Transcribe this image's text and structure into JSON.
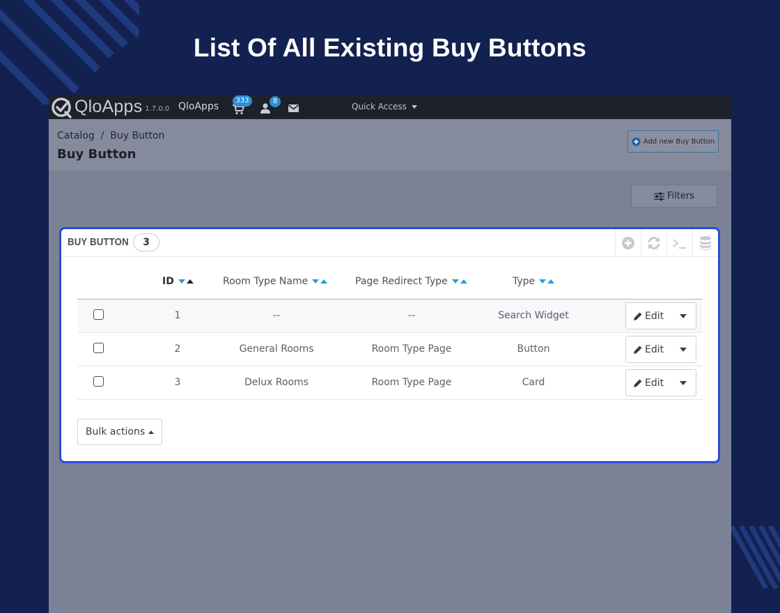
{
  "headline": "List Of All Existing Buy Buttons",
  "topbar": {
    "brand": "QloApps",
    "version": "1.7.0.0",
    "shop_name": "QloApps",
    "cart_badge": "333",
    "customer_badge": "8",
    "quick_access": "Quick Access",
    "icons": [
      "cart-icon",
      "user-icon",
      "envelope-icon"
    ]
  },
  "header": {
    "breadcrumb": "Catalog  /  Buy Button",
    "title": "Buy Button",
    "add_button": "Add new Buy Button"
  },
  "filters_label": "Filters",
  "panel": {
    "title": "BUY BUTTON",
    "count": "3",
    "tools": [
      "add-icon",
      "refresh-icon",
      "terminal-icon",
      "database-icon"
    ]
  },
  "table": {
    "columns": [
      "ID",
      "Room Type Name",
      "Page Redirect Type",
      "Type"
    ],
    "rows": [
      {
        "id": "1",
        "room_type_name": "--",
        "page_redirect_type": "--",
        "type": "Search Widget",
        "action": "Edit"
      },
      {
        "id": "2",
        "room_type_name": "General Rooms",
        "page_redirect_type": "Room Type Page",
        "type": "Button",
        "action": "Edit"
      },
      {
        "id": "3",
        "room_type_name": "Delux Rooms",
        "page_redirect_type": "Room Type Page",
        "type": "Card",
        "action": "Edit"
      }
    ]
  },
  "bulk_actions": "Bulk actions",
  "colors": {
    "background": "#12214f",
    "accent_blue": "#2a4bd8",
    "sort_arrow": "#1ba3d8",
    "topbar": "#1d2129"
  }
}
